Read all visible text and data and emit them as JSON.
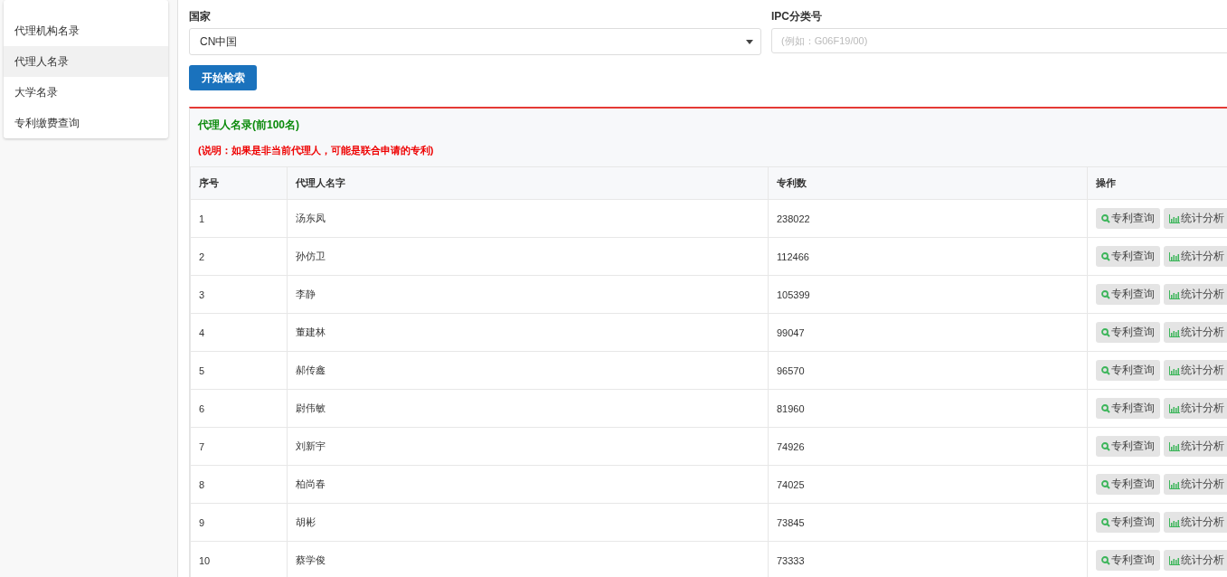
{
  "sidebar": {
    "items": [
      {
        "label": "代理机构名录",
        "selected": false
      },
      {
        "label": "代理人名录",
        "selected": true
      },
      {
        "label": "大学名录",
        "selected": false
      },
      {
        "label": "专利缴费查询",
        "selected": false
      }
    ]
  },
  "form": {
    "country": {
      "label": "国家",
      "value": "CN中国"
    },
    "ipc": {
      "label": "IPC分类号",
      "placeholder": "(例如：G06F19/00)"
    },
    "search_button": "开始检索"
  },
  "panel": {
    "title": "代理人名录(前100名)",
    "note": "(说明：如果是非当前代理人，可能是联合申请的专利)"
  },
  "table": {
    "columns": [
      "序号",
      "代理人名字",
      "专利数",
      "操作"
    ],
    "rows": [
      {
        "cells": [
          "1",
          "汤东凤",
          "238022"
        ],
        "actions": [
          "专利查询",
          "统计分析"
        ]
      },
      {
        "cells": [
          "2",
          "孙仿卫",
          "112466"
        ],
        "actions": [
          "专利查询",
          "统计分析"
        ]
      },
      {
        "cells": [
          "3",
          "李静",
          "105399"
        ],
        "actions": [
          "专利查询",
          "统计分析"
        ]
      },
      {
        "cells": [
          "4",
          "董建林",
          "99047"
        ],
        "actions": [
          "专利查询",
          "统计分析"
        ]
      },
      {
        "cells": [
          "5",
          "郝传鑫",
          "96570"
        ],
        "actions": [
          "专利查询",
          "统计分析"
        ]
      },
      {
        "cells": [
          "6",
          "尉伟敏",
          "81960"
        ],
        "actions": [
          "专利查询",
          "统计分析"
        ]
      },
      {
        "cells": [
          "7",
          "刘新宇",
          "74926"
        ],
        "actions": [
          "专利查询",
          "统计分析"
        ]
      },
      {
        "cells": [
          "8",
          "柏尚春",
          "74025"
        ],
        "actions": [
          "专利查询",
          "统计分析"
        ]
      },
      {
        "cells": [
          "9",
          "胡彬",
          "73845"
        ],
        "actions": [
          "专利查询",
          "统计分析"
        ]
      },
      {
        "cells": [
          "10",
          "蔡学俊",
          "73333"
        ],
        "actions": [
          "专利查询",
          "统计分析"
        ]
      }
    ]
  }
}
